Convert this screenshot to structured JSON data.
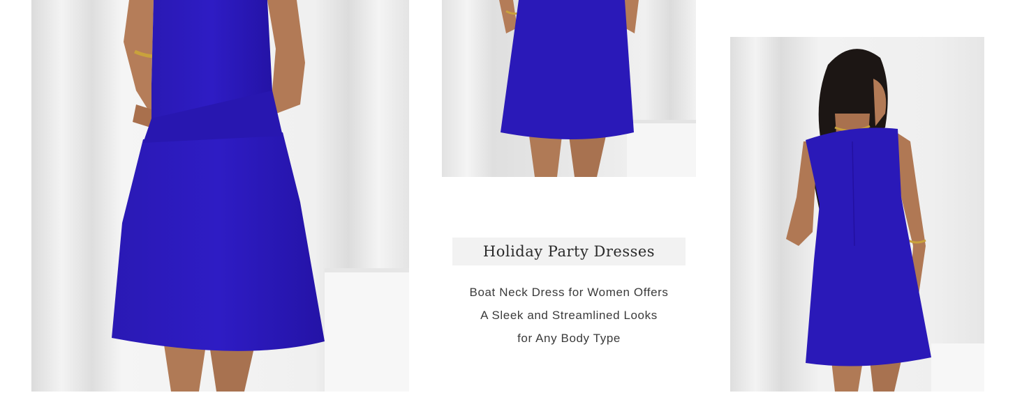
{
  "title": "Holiday Party Dresses",
  "description_lines": [
    "Boat Neck Dress for Women Offers",
    "A Sleek and Streamlined Looks",
    "for Any Body Type"
  ],
  "colors": {
    "dress": "#2a17b8",
    "background": "#ffffff",
    "title_box": "#f2f2f2"
  }
}
